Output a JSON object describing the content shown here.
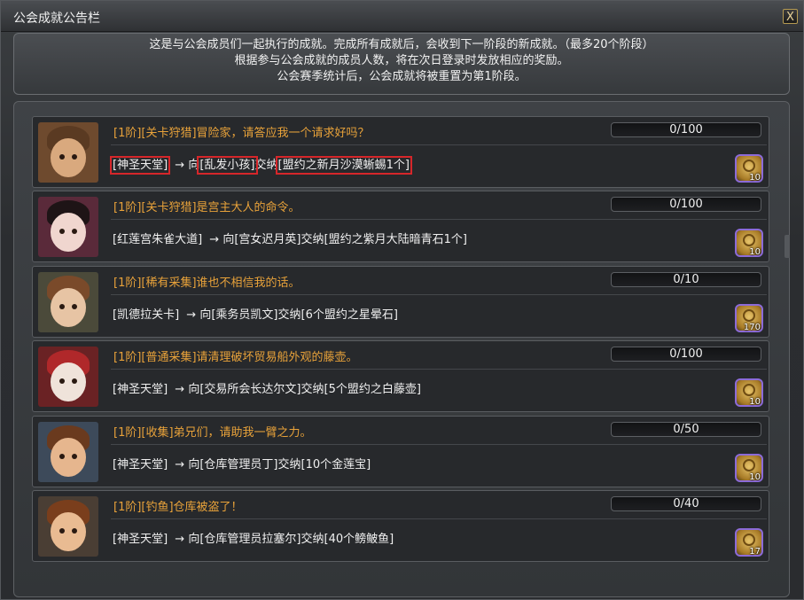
{
  "window": {
    "title": "公会成就公告栏",
    "close_label": "X"
  },
  "notice": {
    "lines": [
      "这是与公会成员们一起执行的成就。完成所有成就后，会收到下一阶段的新成就。（最多20个阶段）",
      "根据参与公会成就的成员人数，将在次日登录时发放相应的奖励。",
      "公会赛季统计后，公会成就将被重置为第1阶段。"
    ]
  },
  "achievements": [
    {
      "title": "[1阶][关卡狩猎]冒险家，请答应我一个请求好吗？",
      "progress_text": "0/100",
      "progress_fraction": 0,
      "location": "[神圣天堂]",
      "arrow": "→",
      "to_prefix": "向",
      "npc": "[乱发小孩]",
      "verb": "交纳",
      "item": "[盟约之新月沙漠蜥蜴1个]",
      "reward_count": "10",
      "highlighted": true
    },
    {
      "title": "[1阶][关卡狩猎]是宫主大人的命令。",
      "progress_text": "0/100",
      "progress_fraction": 0,
      "location": "[红莲宫朱雀大道]",
      "arrow": "→",
      "to_prefix": "向",
      "npc": "[宫女迟月英]",
      "verb": "交纳",
      "item": "[盟约之紫月大陆暗青石1个]",
      "reward_count": "10",
      "highlighted": false
    },
    {
      "title": "[1阶][稀有采集]谁也不相信我的话。",
      "progress_text": "0/10",
      "progress_fraction": 0,
      "location": "[凯德拉关卡]",
      "arrow": "→",
      "to_prefix": "向",
      "npc": "[乘务员凯文]",
      "verb": "交纳",
      "item": "[6个盟约之星晕石]",
      "reward_count": "170",
      "highlighted": false
    },
    {
      "title": "[1阶][普通采集]请清理破坏贸易船外观的藤壶。",
      "progress_text": "0/100",
      "progress_fraction": 0,
      "location": "[神圣天堂]",
      "arrow": "→",
      "to_prefix": "向",
      "npc": "[交易所会长达尔文]",
      "verb": "交纳",
      "item": "[5个盟约之白藤壶]",
      "reward_count": "10",
      "highlighted": false
    },
    {
      "title": "[1阶][收集]弟兄们，请助我一臂之力。",
      "progress_text": "0/50",
      "progress_fraction": 0,
      "location": "[神圣天堂]",
      "arrow": "→",
      "to_prefix": "向",
      "npc": "[仓库管理员丁]",
      "verb": "交纳",
      "item": "[10个金莲宝]",
      "reward_count": "10",
      "highlighted": false
    },
    {
      "title": "[1阶][钓鱼]仓库被盗了！",
      "progress_text": "0/40",
      "progress_fraction": 0,
      "location": "[神圣天堂]",
      "arrow": "→",
      "to_prefix": "向",
      "npc": "[仓库管理员拉塞尔]",
      "verb": "交纳",
      "item": "[40个鳑鲏鱼]",
      "reward_count": "17",
      "highlighted": false
    }
  ],
  "colors": {
    "title_orange": "#e8a23a",
    "highlight_red": "#d6262a",
    "reward_border": "#8c6bd8"
  }
}
